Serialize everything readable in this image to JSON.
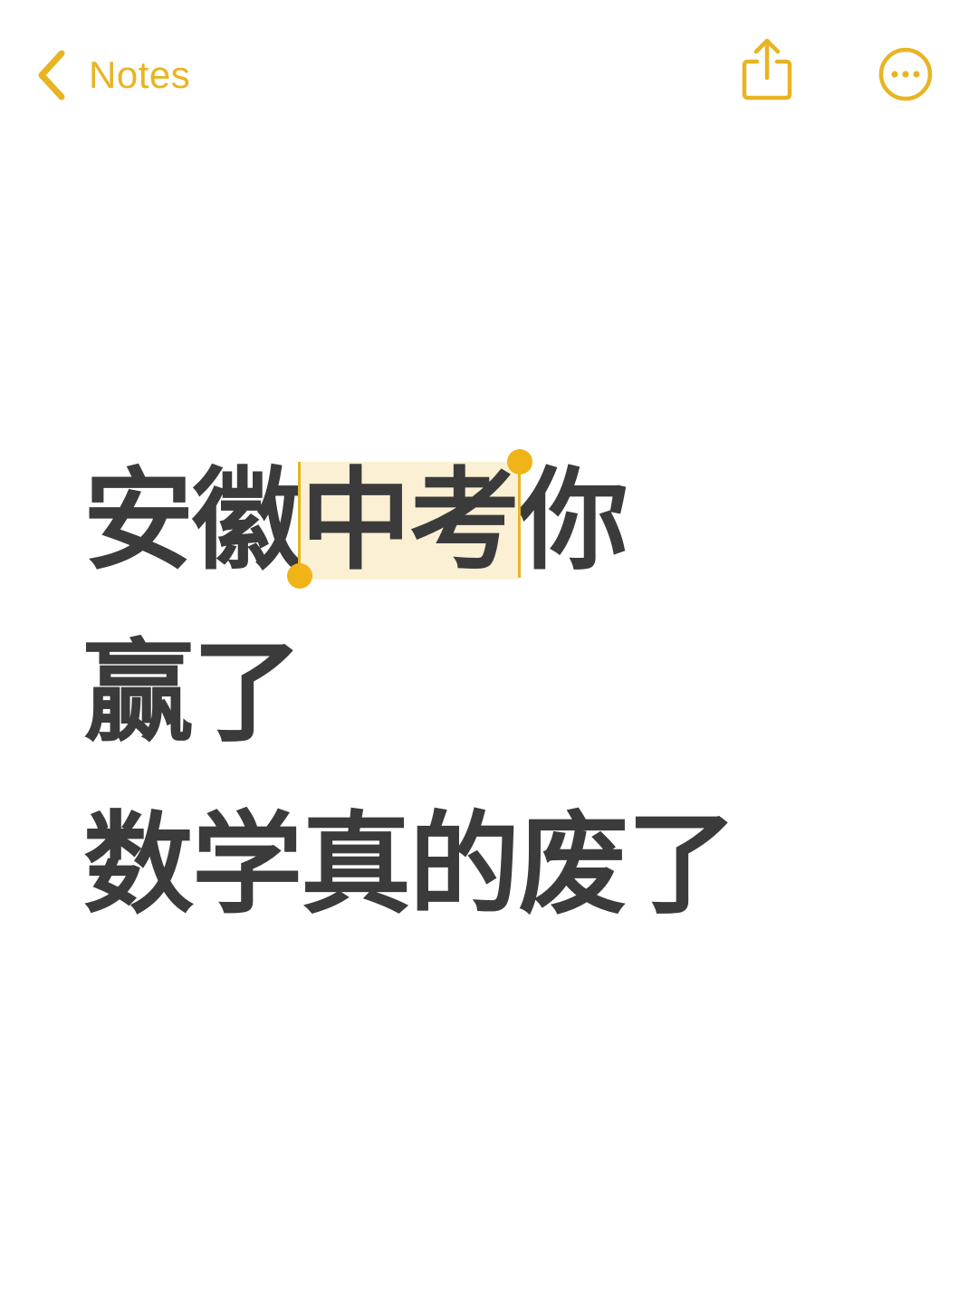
{
  "nav": {
    "back_label": "Notes",
    "accent_color": "#E8B422",
    "icons": {
      "back": "chevron-left-icon",
      "share": "share-icon",
      "more": "ellipsis-circle-icon"
    }
  },
  "note": {
    "lines": [
      {
        "before_selection": "安徽",
        "selected": "中考",
        "after_selection": "你"
      },
      {
        "text": "赢了"
      },
      {
        "text": "数学真的废了"
      }
    ],
    "text_color": "#3b3b3b",
    "selection_color": "#FBF0D4",
    "selection_handle_color": "#F0B418"
  }
}
